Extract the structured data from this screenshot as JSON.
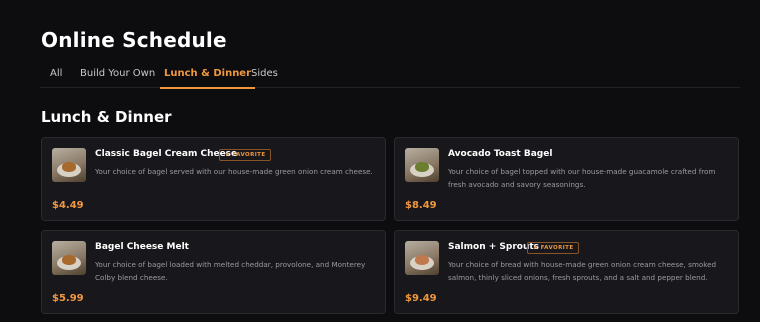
{
  "page": {
    "title": "Online Schedule"
  },
  "tabs": [
    {
      "label": "All"
    },
    {
      "label": "Build Your Own"
    },
    {
      "label": "Lunch & Dinner",
      "active": true
    },
    {
      "label": "Sides"
    }
  ],
  "section": {
    "title": "Lunch & Dinner"
  },
  "items": [
    {
      "name": "Classic Bagel Cream Cheese",
      "badge": "★ FAVORITE",
      "description": "Your choice of bagel served with our house-made green onion cream cheese.",
      "price": "$4.49"
    },
    {
      "name": "Avocado Toast Bagel",
      "description": "Your choice of bagel topped with our house-made guacamole crafted from fresh avocado and savory seasonings.",
      "price": "$8.49"
    },
    {
      "name": "Bagel Cheese Melt",
      "description": "Your choice of bagel loaded with melted cheddar, provolone, and Monterey Colby blend cheese.",
      "price": "$5.99"
    },
    {
      "name": "Salmon + Sprouts",
      "badge": "★ FAVORITE",
      "description": "Your choice of bread with house-made green onion cream cheese, smoked salmon, thinly sliced onions, fresh sprouts, and a salt and pepper blend.",
      "price": "$9.49"
    }
  ],
  "colors": {
    "accent": "#f0983f",
    "background": "#0d0c0e",
    "card": "#18171b"
  }
}
